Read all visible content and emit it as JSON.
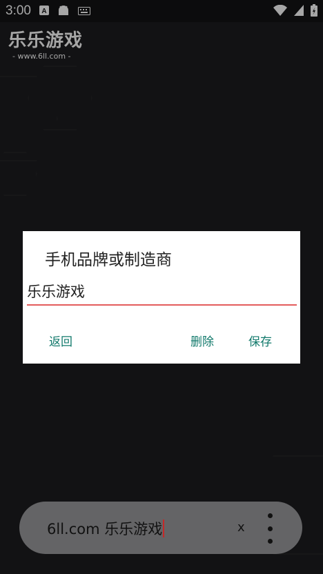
{
  "status_bar": {
    "time": "3:00",
    "icons": [
      "keyboard-a-icon",
      "android-icon",
      "keyboard-icon",
      "wifi-icon",
      "signal-icon",
      "battery-icon"
    ]
  },
  "app": {
    "logo_title": "乐乐游戏",
    "logo_subtitle": "- www.6ll.com -"
  },
  "dialog": {
    "title": "手机品牌或制造商",
    "input_value": "乐乐游戏",
    "buttons": {
      "back": "返回",
      "delete": "删除",
      "save": "保存"
    },
    "accent_color": "#11796b",
    "underline_color": "#e35b5b"
  },
  "bottom_bar": {
    "text": "6ll.com 乐乐游戏",
    "close_label": "x"
  }
}
